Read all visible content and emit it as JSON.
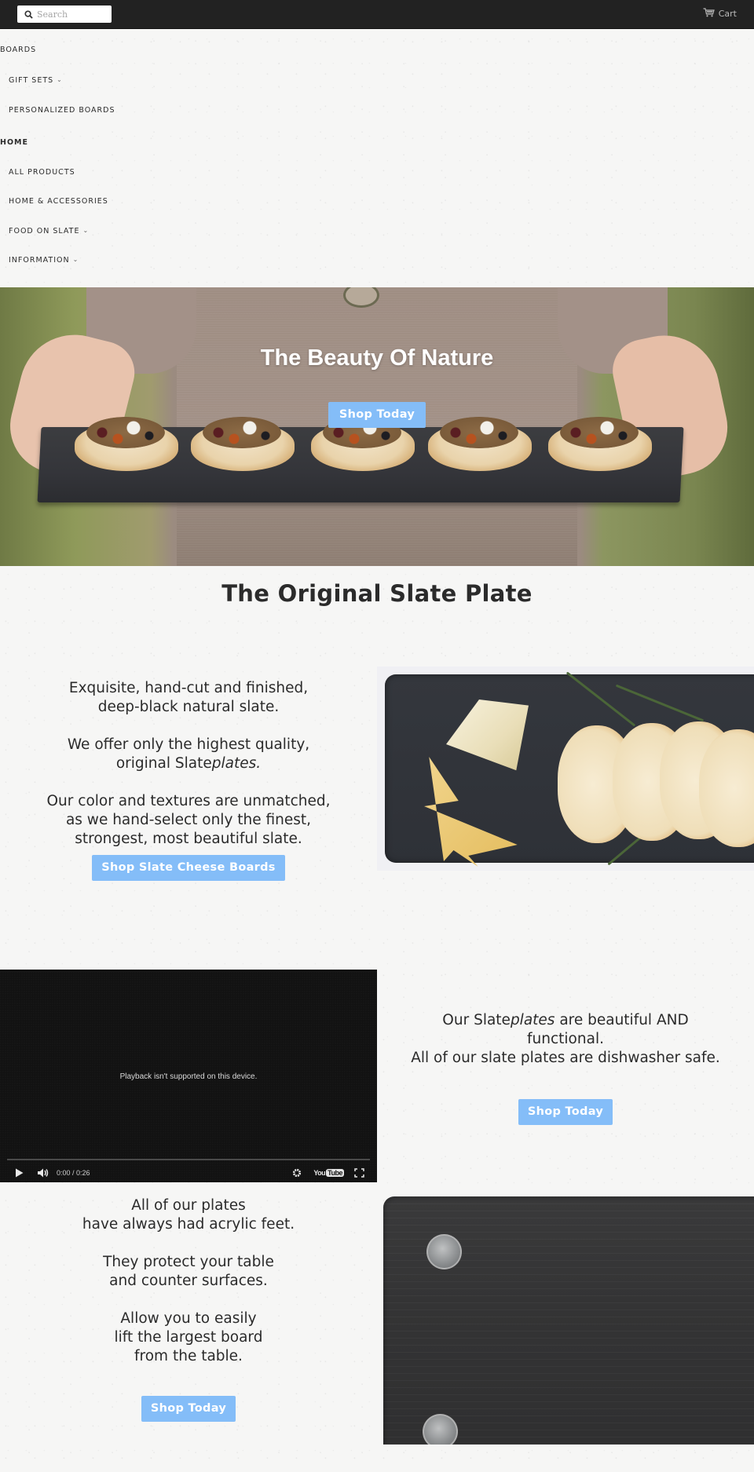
{
  "topbar": {
    "search_placeholder": "Search",
    "search_icon": "search-icon",
    "cart_label": "Cart",
    "cart_icon": "cart-icon"
  },
  "nav": {
    "items": [
      {
        "label": "Boards",
        "level": "top",
        "bold": false,
        "has_dropdown": false
      },
      {
        "label": "Gift Sets",
        "level": "sub",
        "bold": false,
        "has_dropdown": true
      },
      {
        "label": "Personalized Boards",
        "level": "sub",
        "bold": false,
        "has_dropdown": false
      },
      {
        "label": "Home",
        "level": "top",
        "bold": true,
        "has_dropdown": false
      },
      {
        "label": "All Products",
        "level": "sub",
        "bold": false,
        "has_dropdown": false
      },
      {
        "label": "Home & Accessories",
        "level": "sub",
        "bold": false,
        "has_dropdown": false
      },
      {
        "label": "Food On Slate",
        "level": "sub",
        "bold": false,
        "has_dropdown": true
      },
      {
        "label": "Information",
        "level": "sub",
        "bold": false,
        "has_dropdown": true
      }
    ],
    "dropdown_icon": "chevron-down-icon"
  },
  "hero": {
    "title": "The Beauty Of Nature",
    "button_label": "Shop Today"
  },
  "main": {
    "title": "The Original Slate Plate"
  },
  "feature1": {
    "paragraphs": [
      [
        "Exquisite, hand-cut and finished,",
        "deep-black natural slate."
      ],
      [
        "We offer only the highest quality,",
        "original Slate",
        "plates",
        "."
      ],
      [
        "Our color and textures are unmatched,",
        "as we hand-select only the finest,",
        "strongest, most beautiful slate."
      ]
    ],
    "button_label": "Shop Slate Cheese Boards",
    "image_alt": "Slate board with cheese and bread"
  },
  "feature2": {
    "video": {
      "message": "Playback isn't supported on this device.",
      "time": "0:00 / 0:26",
      "progress": 0,
      "logo_you": "You",
      "logo_tube": "Tube"
    },
    "line1_pre": "Our Slate",
    "line1_em": "plates",
    "line1_post": " are beautiful AND",
    "line2": "functional.",
    "line3": "All of our slate plates are dishwasher safe.",
    "button_label": "Shop Today"
  },
  "feature3": {
    "paragraphs": [
      [
        "All of our plates",
        "have always had acrylic feet."
      ],
      [
        "They protect your table",
        "and counter surfaces."
      ],
      [
        "Allow you to easily",
        "lift the largest board",
        "from the table."
      ]
    ],
    "button_label": "Shop Today",
    "image_alt": "Slate board with acrylic feet"
  },
  "colors": {
    "topbar_bg": "#222222",
    "button_bg": "#84bdf8",
    "text": "#2b2b2b",
    "video_bg": "#121212"
  }
}
